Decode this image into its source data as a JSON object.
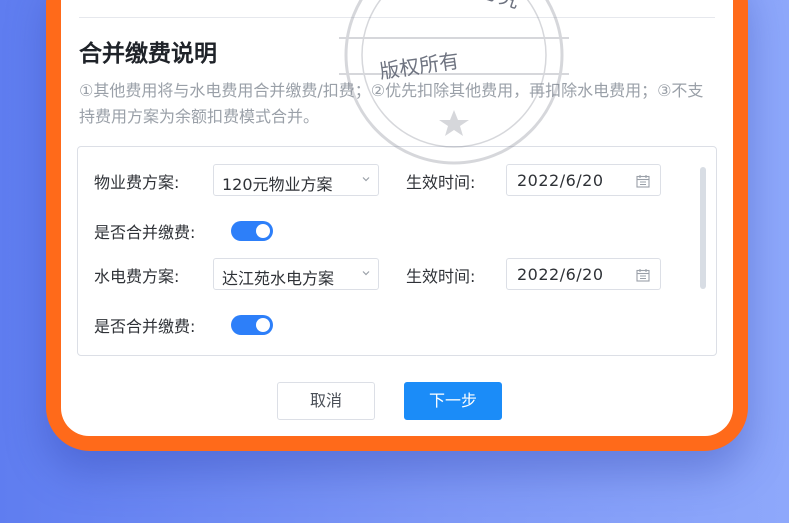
{
  "dialog": {
    "title": "合并缴费说明",
    "description": "①其他费用将与水电费用合并缴费/扣费；②优先扣除其他费用，再扣除水电费用；③不支持费用方案为余额扣费模式合并。"
  },
  "rows": [
    {
      "plan_label": "物业费方案:",
      "plan_value": "120元物业方案",
      "effective_label": "生效时间:",
      "effective_value": "2022/6/20",
      "merge_label": "是否合并缴费:",
      "merge_on": true
    },
    {
      "plan_label": "水电费方案:",
      "plan_value": "达江苑水电方案",
      "effective_label": "生效时间:",
      "effective_value": "2022/6/20",
      "merge_label": "是否合并缴费:",
      "merge_on": true
    }
  ],
  "buttons": {
    "cancel": "取消",
    "next": "下一步"
  },
  "watermark": {
    "text_top": "版权所有  盗图必究",
    "text_mid": "版权所有"
  },
  "icons": {
    "caret": "chevron-down-icon",
    "calendar": "calendar-icon"
  },
  "colors": {
    "device_frame": "#ff6a1a",
    "background": "#6f8bf3",
    "primary": "#1b8cf8",
    "switch_on": "#2d7ff9"
  }
}
